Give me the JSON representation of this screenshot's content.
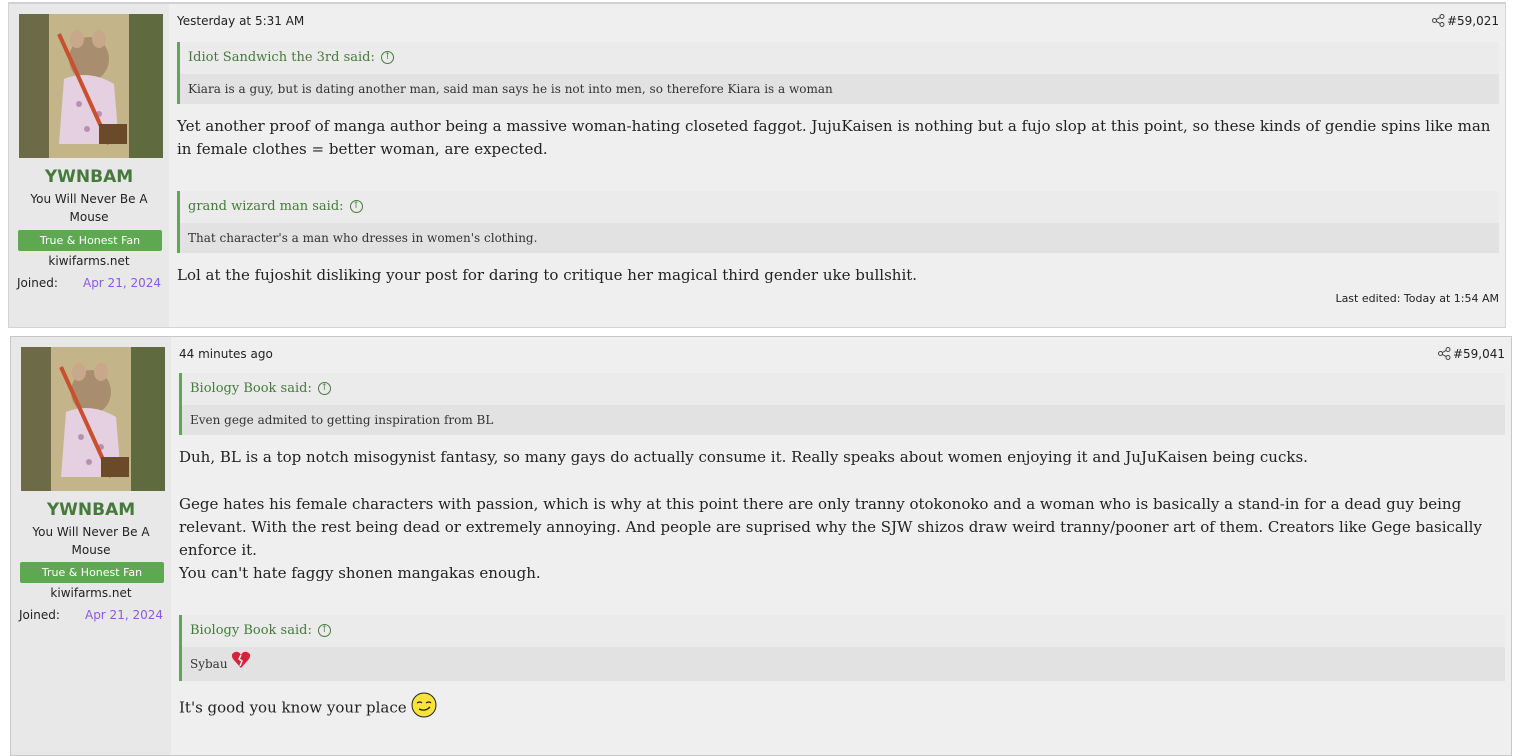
{
  "posts": [
    {
      "user": {
        "name": "YWNBAM",
        "title": "You Will Never Be A Mouse",
        "banner": "True & Honest Fan",
        "site": "kiwifarms.net",
        "joined_label": "Joined:",
        "joined_date": "Apr 21, 2024"
      },
      "date": "Yesterday at 5:31 AM",
      "post_number": "#59,021",
      "quotes": [
        {
          "author": "Idiot Sandwich the 3rd said:",
          "text": "Kiara is a guy, but is dating another man, said man says he is not into men, so therefore Kiara is a woman"
        },
        {
          "author": "grand wizard man said:",
          "text": "That character's a man who dresses in women's clothing."
        }
      ],
      "paragraphs": [
        "Yet another proof of manga author being a massive woman-hating closeted faggot. JujuKaisen is nothing but a fujo slop at this point, so these kinds of gendie spins like man in female clothes = better woman, are expected.",
        "Lol at the fujoshit disliking your post for daring to critique her magical third gender uke bullshit."
      ],
      "last_edited": "Last edited: Today at 1:54 AM"
    },
    {
      "user": {
        "name": "YWNBAM",
        "title": "You Will Never Be A Mouse",
        "banner": "True & Honest Fan",
        "site": "kiwifarms.net",
        "joined_label": "Joined:",
        "joined_date": "Apr 21, 2024"
      },
      "date": "44 minutes ago",
      "post_number": "#59,041",
      "quotes": [
        {
          "author": "Biology Book said:",
          "text": "Even gege admited to getting inspiration from BL"
        },
        {
          "author": "Biology Book said:",
          "text": "Sybau"
        }
      ],
      "paragraphs": [
        "Duh, BL is a top notch misogynist fantasy, so many gays do actually consume it. Really speaks about women enjoying it and JuJuKaisen being cucks.",
        "Gege hates his female characters with passion, which is why at this point there are only tranny otokonoko and a woman who is basically a stand-in for a dead guy being relevant. With the rest being dead or extremely annoying. And people are suprised why the SJW shizos draw weird tranny/pooner art of them. Creators like Gege basically enforce it.",
        "You can't hate faggy shonen mangakas enough.",
        "It's good you know your place"
      ],
      "icons": {
        "share": "share-icon",
        "quote_up": "arrow-up-circle-icon",
        "broken_heart": "broken-heart-emoji",
        "smug": "smug-smiley-emoji"
      },
      "colors": {
        "accent": "#5ea852",
        "username": "#467a3c",
        "joined_date": "#8e58e0"
      }
    }
  ]
}
